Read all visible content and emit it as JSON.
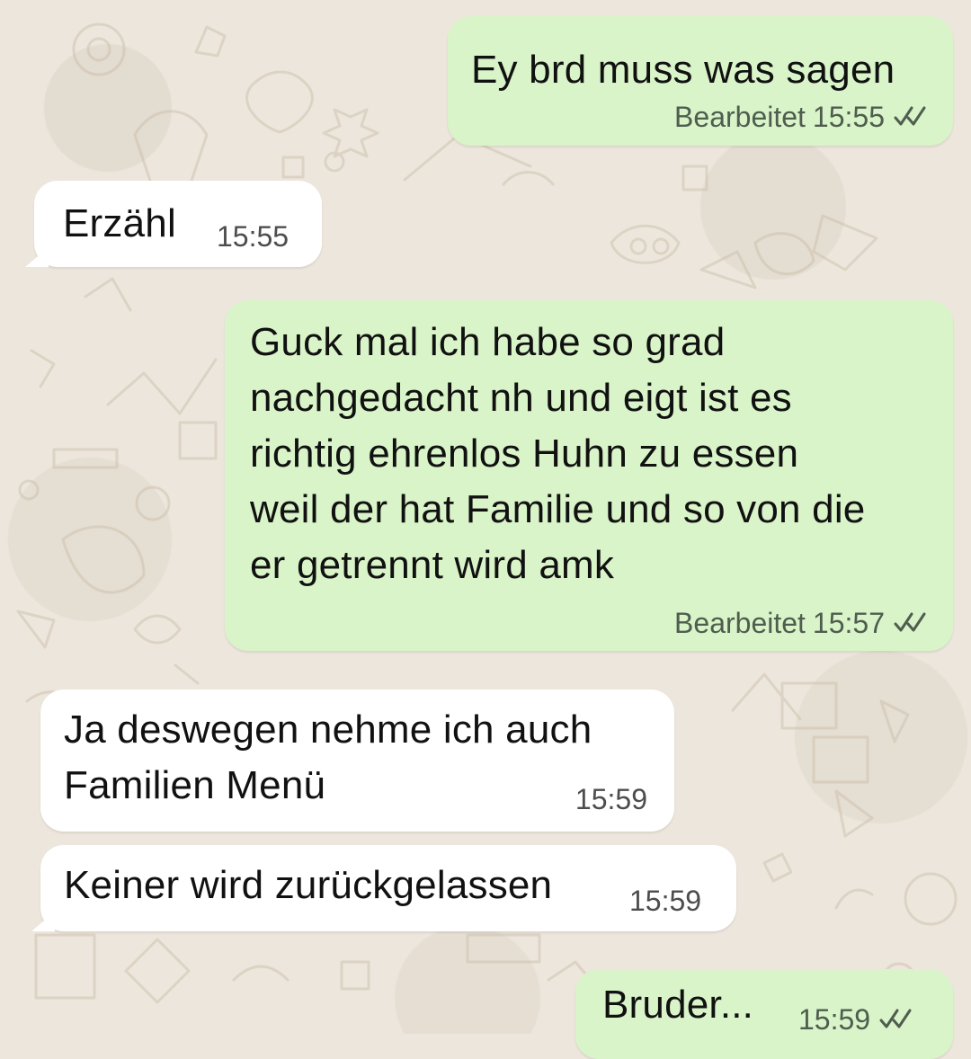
{
  "messages": [
    {
      "direction": "outgoing",
      "text": "Ey brd muss was sagen",
      "edited": "Bearbeitet",
      "time": "15:55",
      "status_icon": "double-check-icon"
    },
    {
      "direction": "incoming",
      "text": "Erzähl",
      "time": "15:55"
    },
    {
      "direction": "outgoing",
      "text": "Guck mal ich habe so grad\nnachgedacht nh und eigt ist es\nrichtig ehrenlos Huhn zu essen\nweil der hat Familie und so von die\ner getrennt wird amk",
      "edited": "Bearbeitet",
      "time": "15:57",
      "status_icon": "double-check-icon"
    },
    {
      "direction": "incoming",
      "text": "Ja deswegen nehme ich auch\nFamilien Menü",
      "time": "15:59"
    },
    {
      "direction": "incoming",
      "text": "Keiner wird zurückgelassen",
      "time": "15:59"
    },
    {
      "direction": "outgoing",
      "text": "Bruder...",
      "time": "15:59",
      "status_icon": "double-check-icon"
    }
  ],
  "colors": {
    "outgoing_bubble": "#d9f4c8",
    "incoming_bubble": "#ffffff",
    "chat_background": "#ece6dc",
    "tick_color": "#4f5d4f"
  }
}
